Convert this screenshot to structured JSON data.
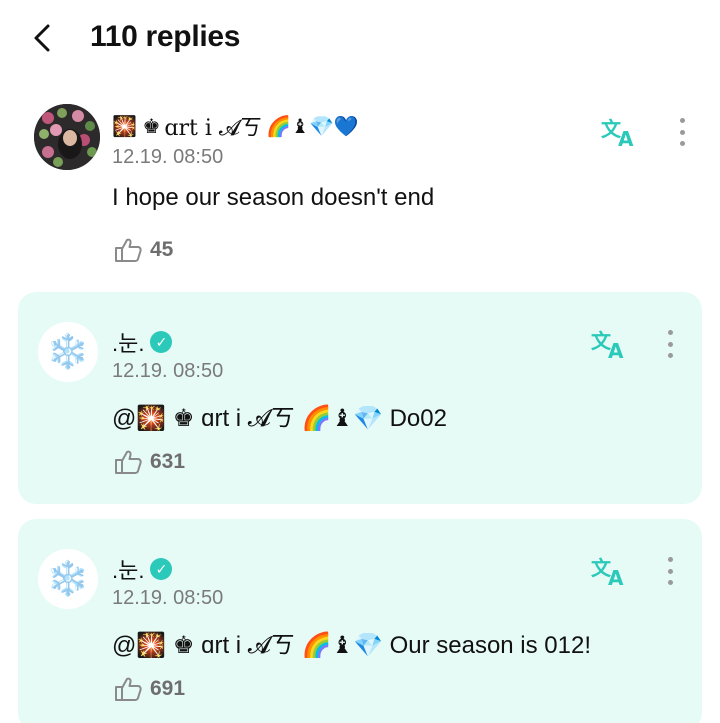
{
  "header": {
    "title": "110 replies"
  },
  "post": {
    "name_prefix": "🎇 ♚",
    "name": "ɑrt i 𝓐ㄎ",
    "name_suffix": "🌈♝💎💙",
    "timestamp": "12.19. 08:50",
    "text": "I hope our season doesn't end",
    "likes": "45"
  },
  "replies": [
    {
      "avatar": "❄️",
      "name": ".눈.",
      "timestamp": "12.19. 08:50",
      "text": "@🎇 ♚ ɑrt i 𝓐ㄎ 🌈♝💎 Do02",
      "likes": "631"
    },
    {
      "avatar": "❄️",
      "name": ".눈.",
      "timestamp": "12.19. 08:50",
      "text": "@🎇 ♚ ɑrt i 𝓐ㄎ 🌈♝💎 Our season is 012!",
      "likes": "691"
    }
  ],
  "colors": {
    "accent": "#2bc9b9",
    "reply_bg": "#e6fbf5",
    "muted": "#7a7a7a"
  },
  "icons": {
    "back": "chevron-left-icon",
    "translate": "translate-icon",
    "more": "more-vertical-icon",
    "like": "like-icon",
    "verified": "verified-badge-icon"
  }
}
